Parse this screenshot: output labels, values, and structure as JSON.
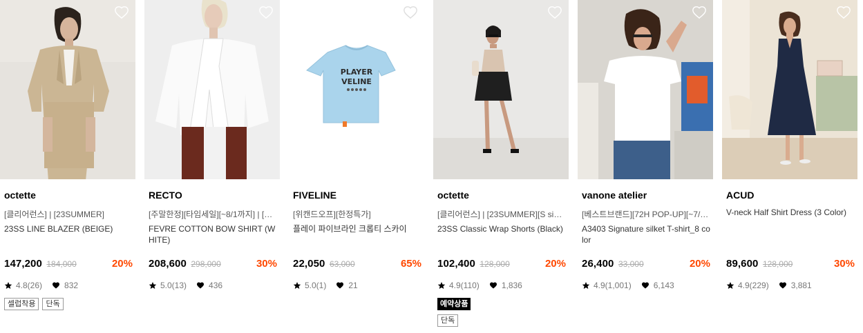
{
  "products": [
    {
      "brand": "octette",
      "tag": "[클리어런스] | [23SUMMER]",
      "name": "23SS LINE BLAZER (BEIGE)",
      "price": "147,200",
      "original_price": "184,000",
      "discount": "20%",
      "rating": "4.8(26)",
      "likes": "832",
      "badges": [
        "셀럽착용",
        "단독"
      ],
      "image": "model-beige-blazer"
    },
    {
      "brand": "RECTO",
      "tag": "[주말한정][타임세일][~8/1까지] | [바…",
      "name": "FEVRE COTTON BOW SHIRT (WHITE)",
      "price": "208,600",
      "original_price": "298,000",
      "discount": "30%",
      "rating": "5.0(13)",
      "likes": "436",
      "badges": [],
      "image": "model-white-bow-shirt"
    },
    {
      "brand": "FIVELINE",
      "tag": "[위캔드오프][한정특가]",
      "name": "플레이 파이브라인 크롭티 스카이",
      "price": "22,050",
      "original_price": "63,000",
      "discount": "65%",
      "rating": "5.0(1)",
      "likes": "21",
      "badges": [],
      "image": "sky-crop-tee",
      "tee_print": [
        "PLAYER",
        "VELINE"
      ]
    },
    {
      "brand": "octette",
      "tag": "[클리어런스] | [23SUMMER][S size …",
      "name": "23SS Classic Wrap Shorts (Black)",
      "price": "102,400",
      "original_price": "128,000",
      "discount": "20%",
      "rating": "4.9(110)",
      "likes": "1,836",
      "badges": [
        "단독"
      ],
      "special_badge": "예약상품",
      "image": "model-black-shorts"
    },
    {
      "brand": "vanone atelier",
      "tag": "[베스트브랜드][72H POP-UP][~7/3…",
      "name": "A3403 Signature silket T-shirt_8 color",
      "price": "26,400",
      "original_price": "33,000",
      "discount": "20%",
      "rating": "4.9(1,001)",
      "likes": "6,143",
      "badges": [],
      "image": "model-white-tshirt"
    },
    {
      "brand": "ACUD",
      "tag": "",
      "name": "V-neck Half Shirt Dress (3 Color)",
      "price": "89,600",
      "original_price": "128,000",
      "discount": "30%",
      "rating": "4.9(229)",
      "likes": "3,881",
      "badges": [],
      "image": "model-navy-dress"
    }
  ],
  "colors": {
    "discount": "#ff4800",
    "original_price": "#aaaaaa",
    "meta_text": "#777777"
  },
  "icons": {
    "wishlist": "heart-outline-icon",
    "rating": "star-icon",
    "likes": "heart-filled-icon"
  }
}
